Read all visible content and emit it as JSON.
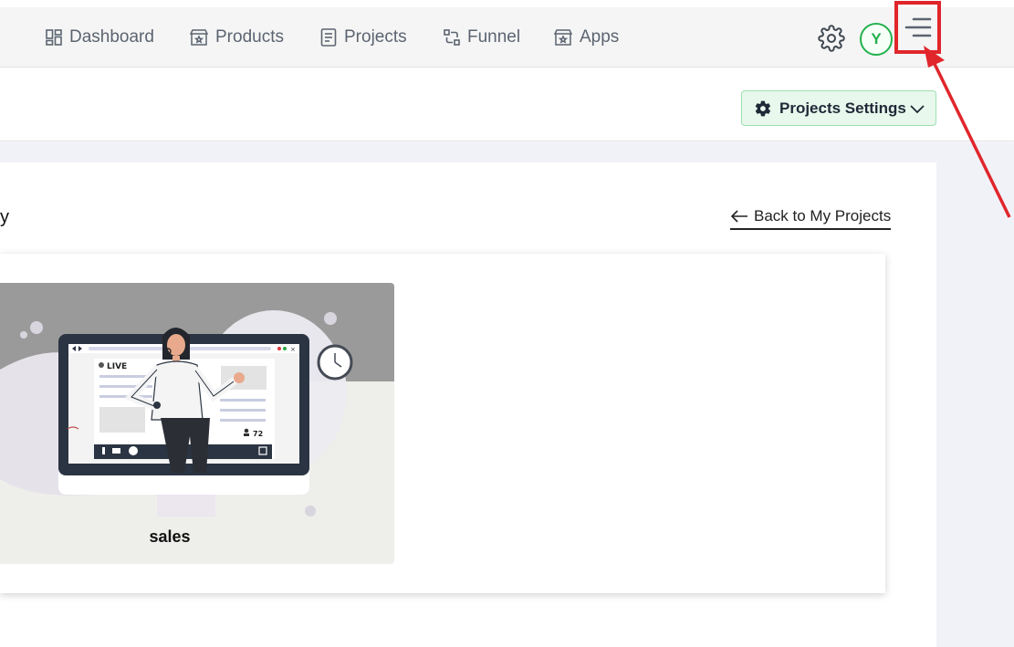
{
  "nav": {
    "items": [
      {
        "label": "Dashboard",
        "icon": "dashboard-grid-icon"
      },
      {
        "label": "Products",
        "icon": "store-icon"
      },
      {
        "label": "Projects",
        "icon": "document-icon"
      },
      {
        "label": "Funnel",
        "icon": "funnel-flow-icon"
      },
      {
        "label": "Apps",
        "icon": "store-icon"
      }
    ],
    "avatar_initial": "Y",
    "settings_icon": "gear-icon",
    "menu_icon": "hamburger-menu-icon"
  },
  "subheader": {
    "settings_button_label": "Projects Settings"
  },
  "main": {
    "title_fragment": "y",
    "back_link_label": "Back to My Projects",
    "projects": [
      {
        "name": "sales",
        "live_label": "LIVE",
        "viewer_count": "72"
      }
    ]
  },
  "colors": {
    "accent_green": "#22b14c",
    "settings_bg": "#e8f8ec",
    "annotation_red": "#e0262b",
    "nav_text": "#5b6470"
  }
}
